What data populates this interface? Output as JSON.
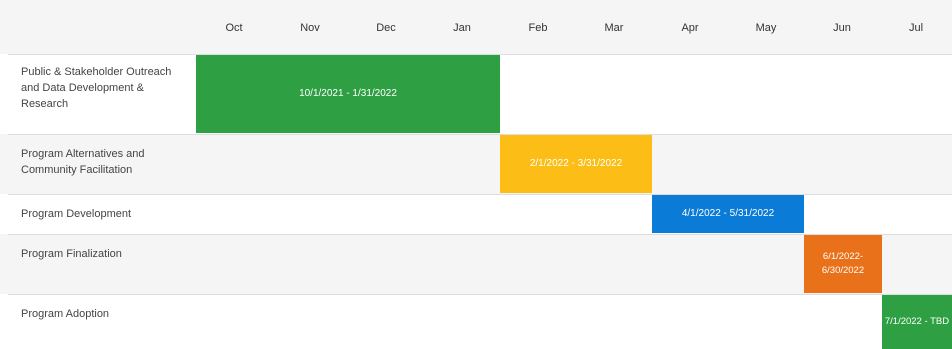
{
  "chart_data": {
    "type": "gantt",
    "months": [
      "Oct",
      "Nov",
      "Dec",
      "Jan",
      "Feb",
      "Mar",
      "Apr",
      "May",
      "Jun",
      "Jul"
    ],
    "tasks": [
      {
        "name": "Public & Stakeholder Outreach and Data Development & Research",
        "start": "2021-10-01",
        "end": "2022-01-31",
        "label": "10/1/2021 - 1/31/2022",
        "color": "#2ea043"
      },
      {
        "name": "Program Alternatives and Community Facilitation",
        "start": "2022-02-01",
        "end": "2022-03-31",
        "label": "2/1/2022 - 3/31/2022",
        "color": "#fbbd16"
      },
      {
        "name": "Program Development",
        "start": "2022-04-01",
        "end": "2022-05-31",
        "label": "4/1/2022 - 5/31/2022",
        "color": "#0b7bd8"
      },
      {
        "name": "Program Finalization",
        "start": "2022-06-01",
        "end": "2022-06-30",
        "label": "6/1/2022- 6/30/2022",
        "color": "#e8711a"
      },
      {
        "name": "Program Adoption",
        "start": "2022-07-01",
        "end": "TBD",
        "label": "7/1/2022 - TBD",
        "color": "#2ea043"
      }
    ]
  }
}
